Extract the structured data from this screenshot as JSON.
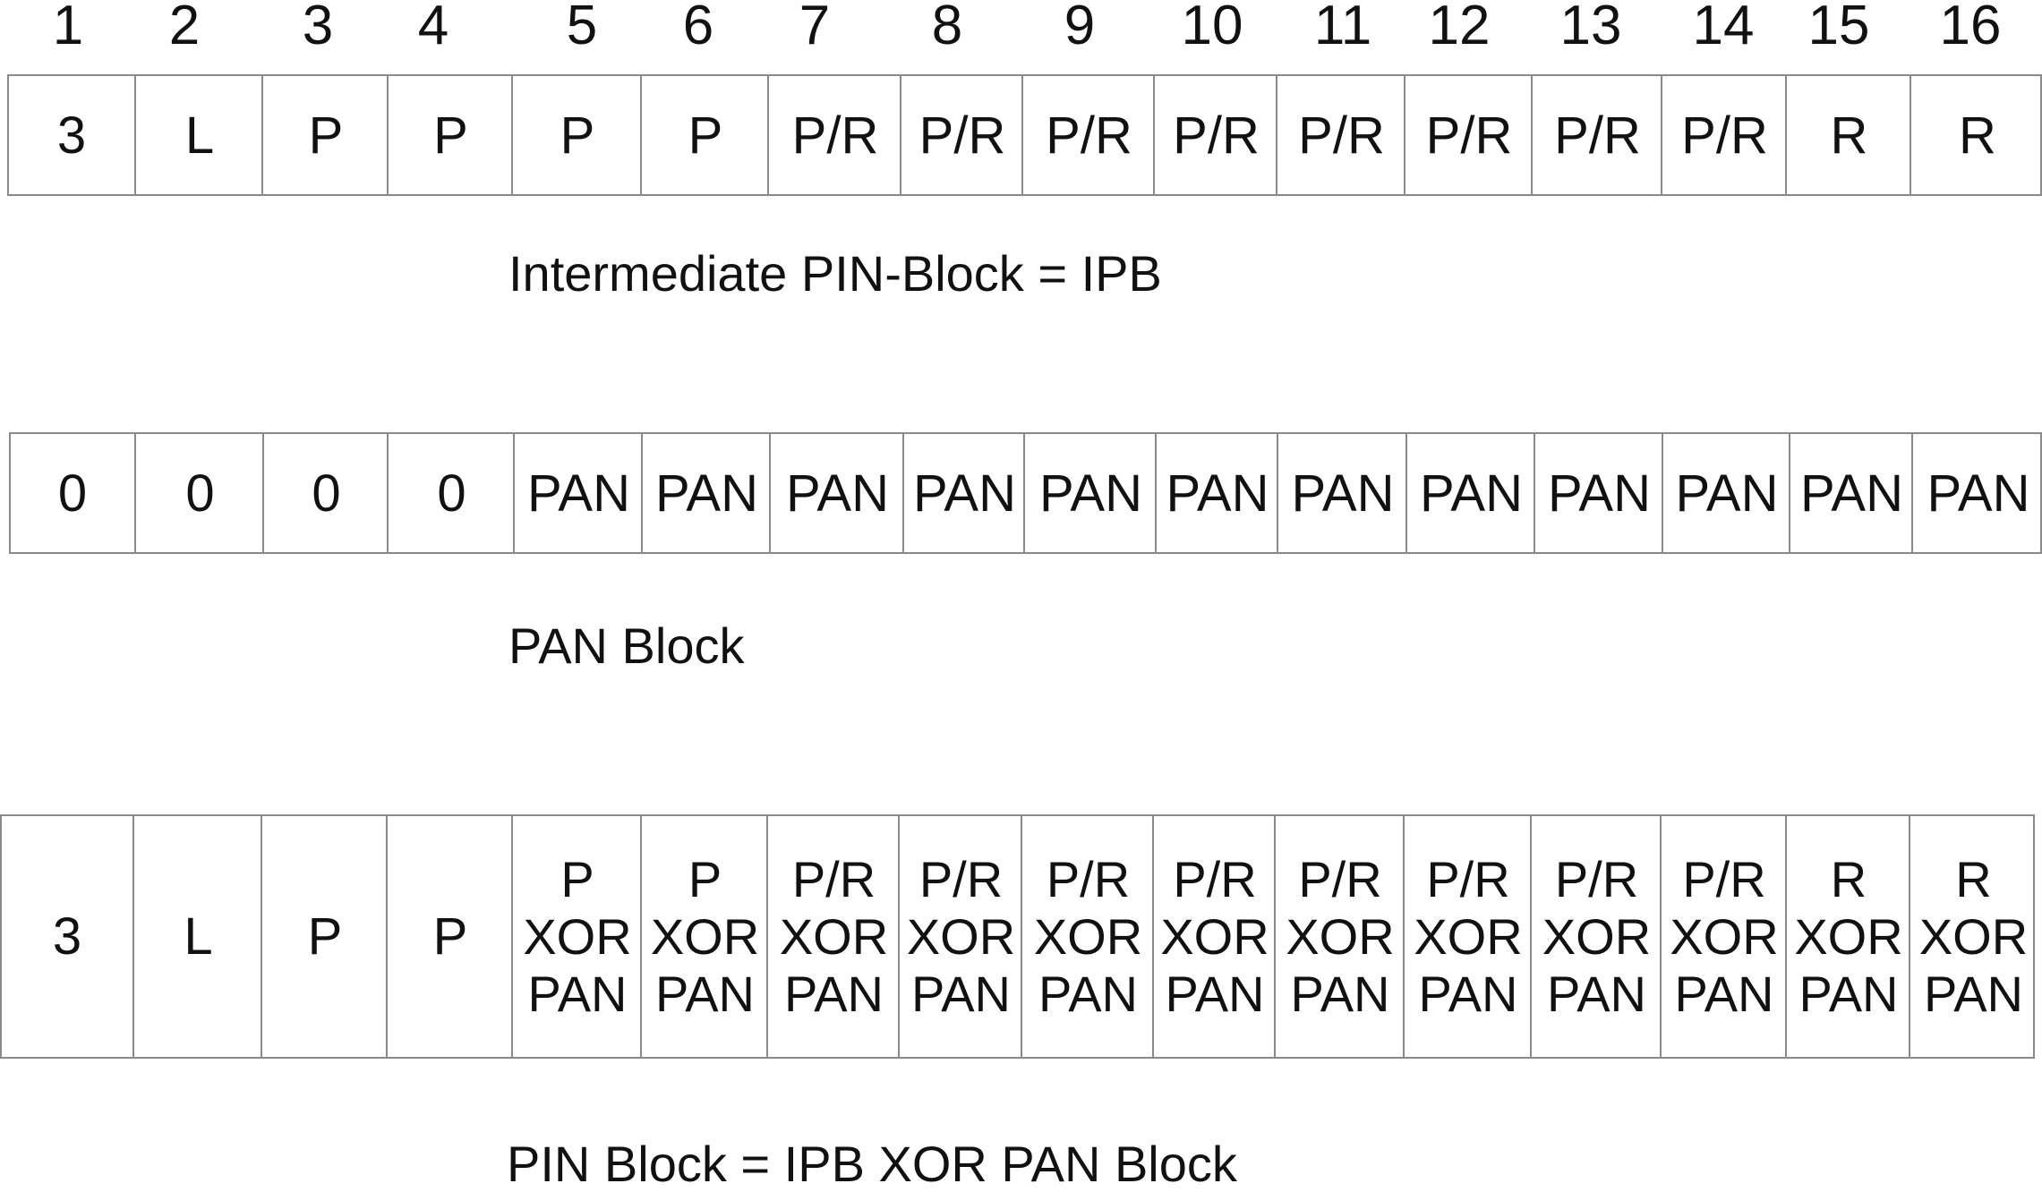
{
  "position_numbers": [
    "1",
    "2",
    "3",
    "4",
    "5",
    "6",
    "7",
    "8",
    "9",
    "10",
    "11",
    "12",
    "13",
    "14",
    "15",
    "16"
  ],
  "ipb_block": {
    "cells": [
      "3",
      "L",
      "P",
      "P",
      "P",
      "P",
      "P/R",
      "P/R",
      "P/R",
      "P/R",
      "P/R",
      "P/R",
      "P/R",
      "P/R",
      "R",
      "R"
    ],
    "caption": "Intermediate PIN-Block = IPB"
  },
  "pan_block": {
    "cells": [
      "0",
      "0",
      "0",
      "0",
      "PAN",
      "PAN",
      "PAN",
      "PAN",
      "PAN",
      "PAN",
      "PAN",
      "PAN",
      "PAN",
      "PAN",
      "PAN",
      "PAN"
    ],
    "caption": "PAN Block"
  },
  "pin_block": {
    "cells": [
      [
        "3"
      ],
      [
        "L"
      ],
      [
        "P"
      ],
      [
        "P"
      ],
      [
        "P",
        "XOR",
        "PAN"
      ],
      [
        "P",
        "XOR",
        "PAN"
      ],
      [
        "P/R",
        "XOR",
        "PAN"
      ],
      [
        "P/R",
        "XOR",
        "PAN"
      ],
      [
        "P/R",
        "XOR",
        "PAN"
      ],
      [
        "P/R",
        "XOR",
        "PAN"
      ],
      [
        "P/R",
        "XOR",
        "PAN"
      ],
      [
        "P/R",
        "XOR",
        "PAN"
      ],
      [
        "P/R",
        "XOR",
        "PAN"
      ],
      [
        "P/R",
        "XOR",
        "PAN"
      ],
      [
        "R",
        "XOR",
        "PAN"
      ],
      [
        "R",
        "XOR",
        "PAN"
      ]
    ],
    "caption": "PIN Block = IPB XOR PAN Block"
  }
}
